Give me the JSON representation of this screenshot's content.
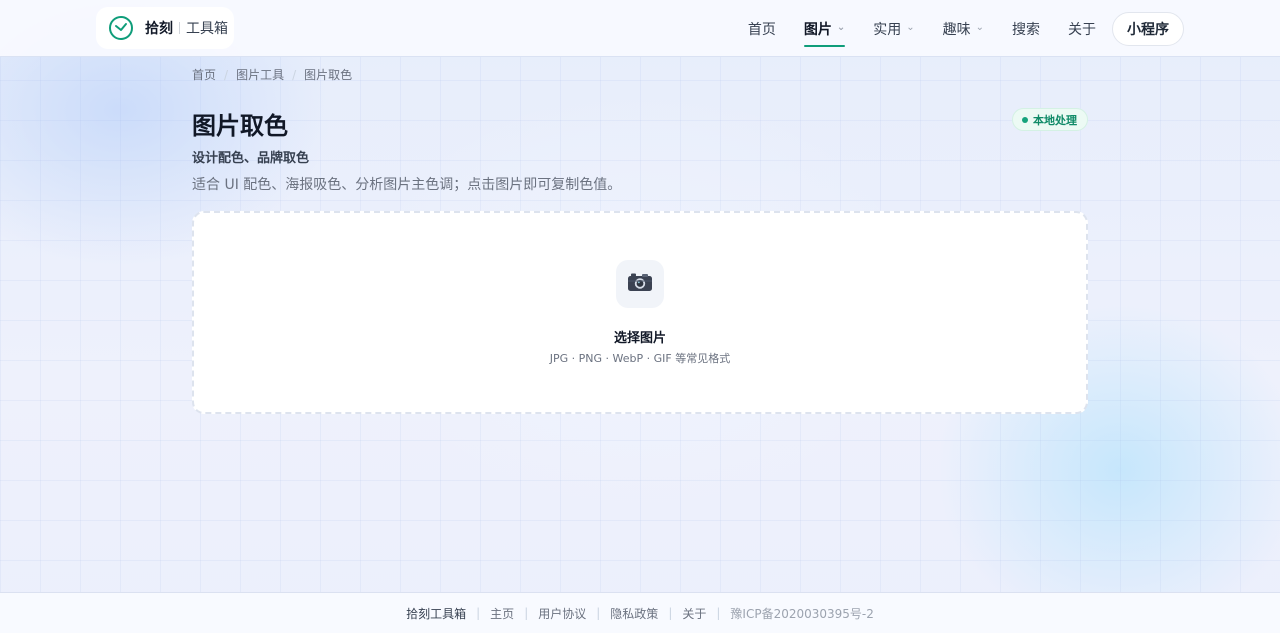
{
  "header": {
    "brand_name": "拾刻",
    "brand_sub": "工具箱",
    "nav": [
      {
        "label": "首页",
        "active": false,
        "dropdown": false
      },
      {
        "label": "图片",
        "active": true,
        "dropdown": true
      },
      {
        "label": "实用",
        "active": false,
        "dropdown": true
      },
      {
        "label": "趣味",
        "active": false,
        "dropdown": true
      },
      {
        "label": "搜索",
        "active": false,
        "dropdown": false
      },
      {
        "label": "关于",
        "active": false,
        "dropdown": false
      }
    ],
    "mini_program_label": "小程序",
    "accent_color": "#0f9d7a"
  },
  "breadcrumb": [
    "首页",
    "图片工具",
    "图片取色"
  ],
  "page": {
    "title": "图片取色",
    "badge": "本地处理",
    "subtitle": "设计配色、品牌取色",
    "description": "适合 UI 配色、海报吸色、分析图片主色调；点击图片即可复制色值。"
  },
  "dropzone": {
    "icon": "camera-icon",
    "label": "选择图片",
    "formats": "JPG · PNG · WebP · GIF 等常见格式"
  },
  "footer": {
    "brand": "拾刻工具箱",
    "links": [
      "主页",
      "用户协议",
      "隐私政策",
      "关于"
    ],
    "icp": "豫ICP备2020030395号-2"
  }
}
